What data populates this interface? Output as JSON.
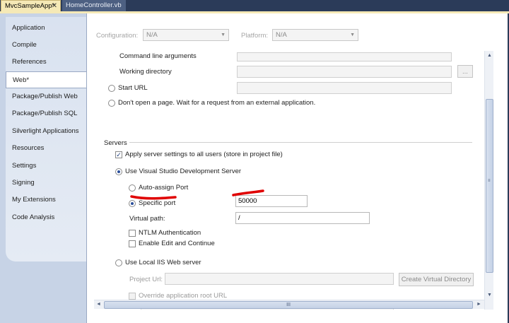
{
  "tabs": [
    {
      "label": "MvcSampleApp*",
      "active": true,
      "close": "✕"
    },
    {
      "label": "HomeController.vb",
      "active": false
    }
  ],
  "sidebar": {
    "items": [
      {
        "label": "Application"
      },
      {
        "label": "Compile"
      },
      {
        "label": "References"
      },
      {
        "label": "Web*",
        "selected": true
      },
      {
        "label": "Package/Publish Web"
      },
      {
        "label": "Package/Publish SQL"
      },
      {
        "label": "Silverlight Applications"
      },
      {
        "label": "Resources"
      },
      {
        "label": "Settings"
      },
      {
        "label": "Signing"
      },
      {
        "label": "My Extensions"
      },
      {
        "label": "Code Analysis"
      }
    ]
  },
  "config": {
    "configuration_label": "Configuration:",
    "configuration_value": "N/A",
    "platform_label": "Platform:",
    "platform_value": "N/A"
  },
  "start_action": {
    "command_line_label": "Command line arguments",
    "working_dir_label": "Working directory",
    "browse_label": "...",
    "start_url_label": "Start URL",
    "dont_open_label": "Don't open a page.  Wait for a request from an external application."
  },
  "servers": {
    "heading": "Servers",
    "apply_all_label": "Apply server settings to all users (store in project file)",
    "use_vs_dev_label": "Use Visual Studio Development Server",
    "auto_assign_label": "Auto-assign Port",
    "specific_port_label": "Specific port",
    "specific_port_value": "50000",
    "virtual_path_label": "Virtual path:",
    "virtual_path_value": "/",
    "ntlm_label": "NTLM Authentication",
    "edit_continue_label": "Enable Edit and Continue",
    "use_iis_label": "Use Local IIS Web server",
    "project_url_label": "Project Url:",
    "create_vdir_label": "Create Virtual Directory",
    "override_root_label": "Override application root URL"
  },
  "scrollbar": {
    "grip": "III",
    "up": "▲",
    "down": "▼",
    "left": "◄",
    "right": "►"
  },
  "colors": {
    "accent_tab": "#f5e9b6",
    "window_frame": "#2b3b59",
    "sidebar": "#d9e2f0",
    "annotation": "#e00000"
  },
  "icons": {
    "combo_arrow": "▼"
  }
}
